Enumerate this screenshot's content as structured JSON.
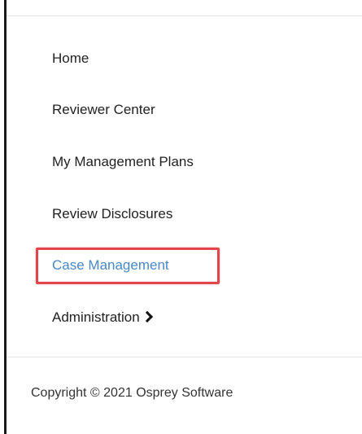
{
  "sidebar": {
    "items": [
      {
        "label": "Home"
      },
      {
        "label": "Reviewer Center"
      },
      {
        "label": "My Management Plans"
      },
      {
        "label": "Review Disclosures"
      },
      {
        "label": "Case Management"
      },
      {
        "label": "Administration"
      }
    ],
    "active_color": "#4a86c6",
    "highlight_color": "#e0464b"
  },
  "footer": {
    "copyright": "Copyright © 2021 Osprey Software"
  }
}
